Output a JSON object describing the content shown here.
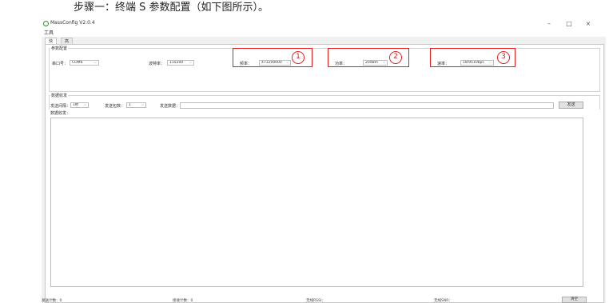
{
  "doc": {
    "heading": "步骤一：终端 S 参数配置（如下图所示）。"
  },
  "window": {
    "title": "MassConfig V2.0.4",
    "min_label": "–",
    "max_label": "□",
    "close_label": "×"
  },
  "menu": {
    "tools": "工具"
  },
  "tabs": [
    {
      "label": "快速"
    },
    {
      "label": "高级"
    }
  ],
  "params": {
    "group_title": "参数配置",
    "port_label": "串口号：",
    "port_value": "COM6",
    "baud_label": "波特率：",
    "baud_value": "115200",
    "freq_label": "频率：",
    "freq_value": "473200000",
    "power_label": "功率：",
    "power_value": "20dBm",
    "rate_label": "速率：",
    "rate_value": "18/9510bps"
  },
  "annotations": [
    "1",
    "2",
    "3"
  ],
  "data_io": {
    "group_title": "数据收发",
    "interval_label": "发送间隔：",
    "interval_value": "1秒",
    "count_label": "发送包数：",
    "count_value": "1",
    "send_data_label": "发送数据：",
    "send_button": "发送",
    "recv_label": "数据收发："
  },
  "status": {
    "sent": "发送计数：0",
    "recv": "接收计数：0",
    "rssi": "无线RSSI：",
    "snr": "无线SNR：",
    "clear_button": "清空"
  }
}
